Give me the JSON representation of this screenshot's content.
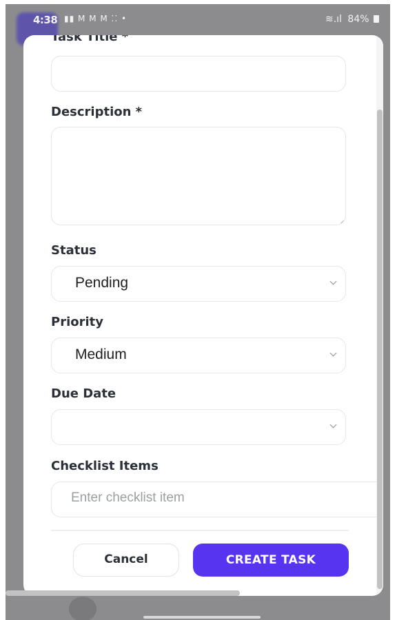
{
  "status_bar": {
    "time": "4:38",
    "notification_icons": "▮▮ M M M ⁚⁚ •",
    "battery": "84%"
  },
  "form": {
    "task_title_label": "Task Title *",
    "description_label": "Description *",
    "status": {
      "label": "Status",
      "value": "Pending"
    },
    "priority": {
      "label": "Priority",
      "value": "Medium"
    },
    "due_date": {
      "label": "Due Date",
      "value": ""
    },
    "checklist": {
      "label": "Checklist Items",
      "placeholder": "Enter checklist item"
    }
  },
  "actions": {
    "cancel_label": "Cancel",
    "create_label": "CREATE TASK"
  },
  "colors": {
    "accent": "#5634f0",
    "backdrop": "#8c8c8e"
  }
}
